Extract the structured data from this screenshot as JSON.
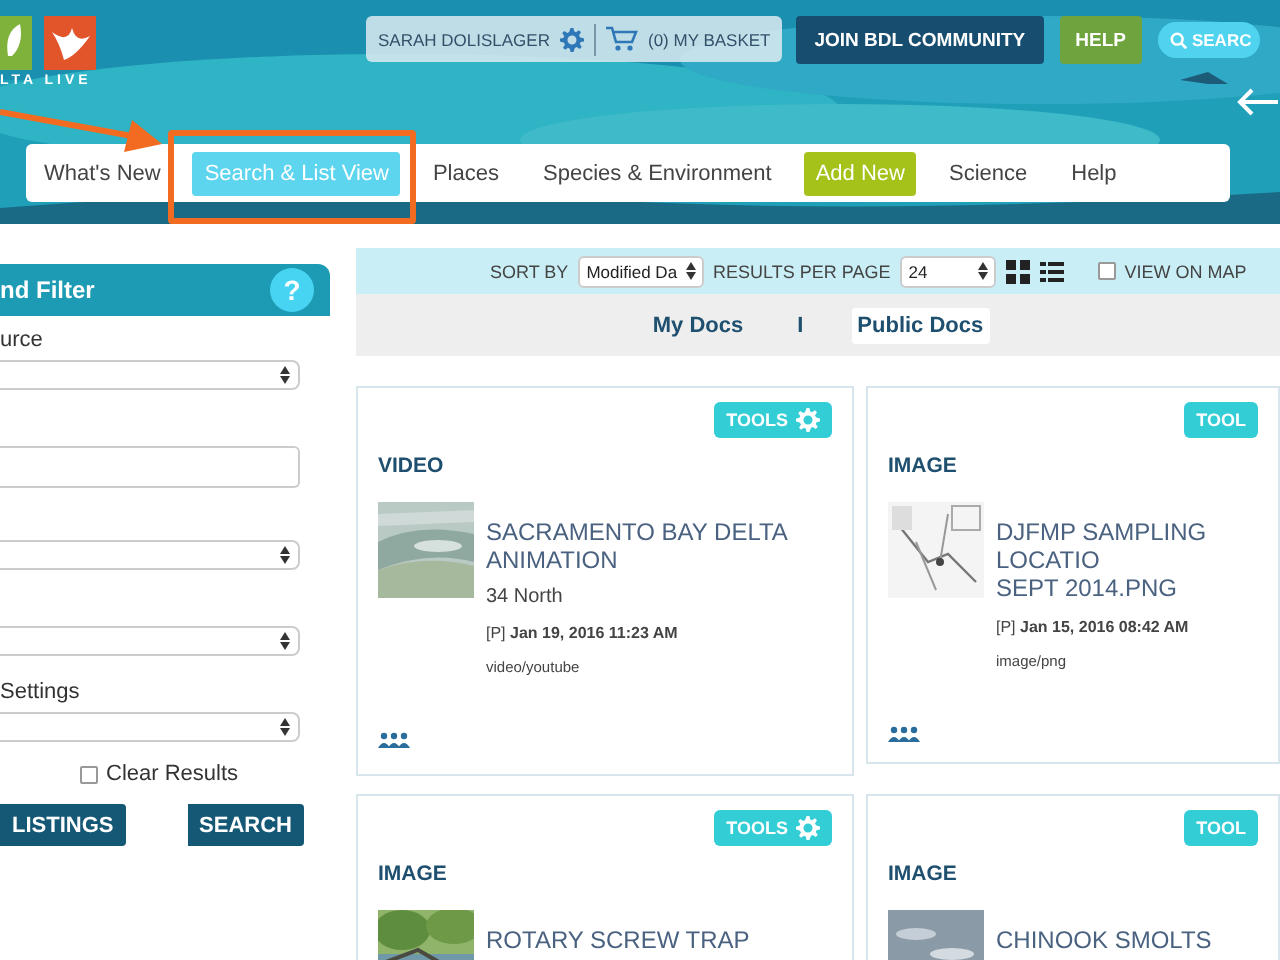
{
  "header": {
    "logo_text": "LTA LIVE",
    "user": "SARAH DOLISLAGER",
    "basket": "(0) MY BASKET",
    "join": "JOIN BDL COMMUNITY",
    "help": "HELP",
    "search": "SEARC"
  },
  "nav": [
    {
      "label": "What's New",
      "selected": false,
      "kind": "link"
    },
    {
      "label": "Search & List View",
      "selected": true,
      "kind": "link"
    },
    {
      "label": "Places",
      "selected": false,
      "kind": "link"
    },
    {
      "label": "Species & Environment",
      "selected": false,
      "kind": "link"
    },
    {
      "label": "Add New",
      "selected": false,
      "kind": "button"
    },
    {
      "label": "Science",
      "selected": false,
      "kind": "link"
    },
    {
      "label": "Help",
      "selected": false,
      "kind": "link"
    }
  ],
  "sidebar": {
    "title": "nd Filter",
    "help_icon": "?",
    "fields": [
      {
        "kind": "select",
        "label": "urce"
      },
      {
        "kind": "text"
      },
      {
        "kind": "select"
      },
      {
        "kind": "select"
      },
      {
        "kind": "select",
        "label": "Settings"
      }
    ],
    "clear_results": {
      "label": "Clear Results",
      "checked": false
    },
    "buttons": [
      "LISTINGS",
      "SEARCH"
    ]
  },
  "toolbar": {
    "sort_label": "SORT BY",
    "sort_value": "Modified Da",
    "per_page_label": "RESULTS PER PAGE",
    "per_page_value": "24",
    "view_on_map": {
      "label": "VIEW ON MAP",
      "checked": false
    }
  },
  "doc_tabs": {
    "items": [
      {
        "label": "My Docs",
        "selected": false
      },
      {
        "label": "Public Docs",
        "selected": true
      }
    ],
    "separator": "I"
  },
  "cards": [
    {
      "tools": "TOOLS",
      "tools_icon": true,
      "type": "VIDEO",
      "title": [
        "SACRAMENTO BAY DELTA ANIMATION"
      ],
      "source": "34 North",
      "date": "[P] **Jan 19, 2016 11:23 AM**",
      "mime": "video/youtube"
    },
    {
      "tools": "TOOL",
      "tools_icon": false,
      "type": "IMAGE",
      "title": [
        "DJFMP SAMPLING LOCATIO",
        "SEPT 2014.PNG"
      ],
      "date": "[P] **Jan 15, 2016 08:42 AM**",
      "mime": "image/png"
    },
    {
      "tools": "TOOLS",
      "tools_icon": true,
      "type": "IMAGE",
      "title": [
        "ROTARY SCREW TRAP"
      ]
    },
    {
      "tools": "TOOL",
      "tools_icon": false,
      "type": "IMAGE",
      "title": [
        "CHINOOK SMOLTS"
      ]
    }
  ]
}
